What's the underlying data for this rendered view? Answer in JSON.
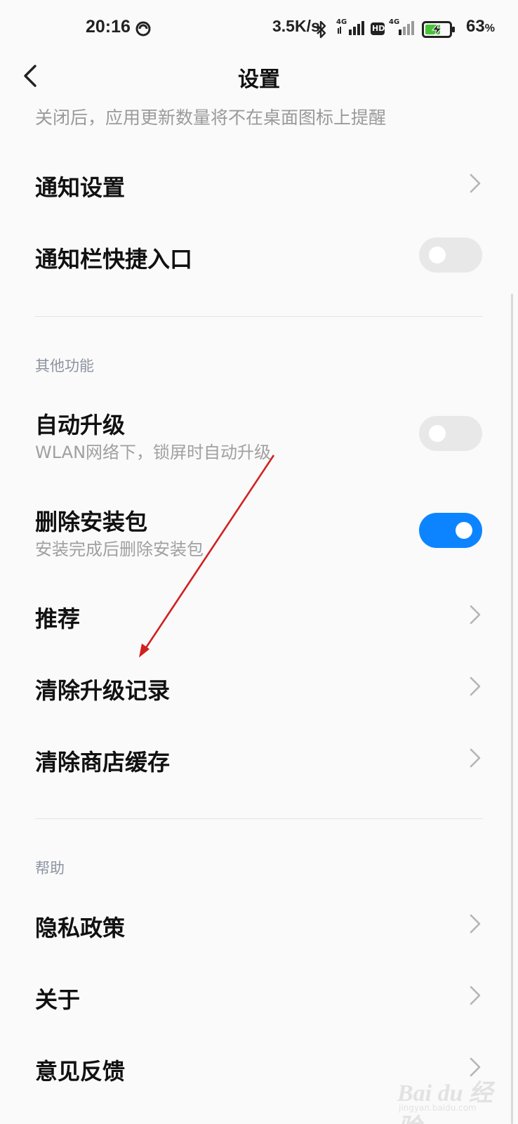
{
  "status_bar": {
    "time": "20:16",
    "net_speed": "3.5K/s",
    "signal1_label": "4G",
    "hd_label": "HD",
    "signal2_label": "4G",
    "battery_percent": "63",
    "battery_unit": "%",
    "battery_level": 0.63,
    "icons": [
      "dnd-icon",
      "bluetooth-icon",
      "signal-icon",
      "hd-icon",
      "signal-icon",
      "battery-charging-icon"
    ]
  },
  "header": {
    "title": "设置",
    "back_icon": "chevron-left-icon"
  },
  "top_description": "关闭后，应用更新数量将不在桌面图标上提醒",
  "rows_notify": [
    {
      "title": "通知设置",
      "control": "chevron"
    },
    {
      "title": "通知栏快捷入口",
      "control": "toggle",
      "on": false
    }
  ],
  "section_other": {
    "header": "其他功能",
    "auto_upgrade": {
      "title": "自动升级",
      "subtitle": "WLAN网络下，锁屏时自动升级",
      "on": false
    },
    "delete_package": {
      "title": "删除安装包",
      "subtitle": "安装完成后删除安装包",
      "on": true
    },
    "recommend": {
      "title": "推荐"
    },
    "clear_upgrade_records": {
      "title": "清除升级记录"
    },
    "clear_store_cache": {
      "title": "清除商店缓存"
    }
  },
  "section_help": {
    "header": "帮助",
    "privacy": {
      "title": "隐私政策"
    },
    "about": {
      "title": "关于"
    },
    "feedback": {
      "title": "意见反馈"
    }
  },
  "colors": {
    "toggle_on": "#0d84ff",
    "toggle_off": "#e8e8e8",
    "annotation_arrow": "#d21f1f",
    "battery_fill": "#49c23a"
  },
  "watermark": {
    "text": "Bai du 经验",
    "sub": "jingyan.baidu.com"
  }
}
